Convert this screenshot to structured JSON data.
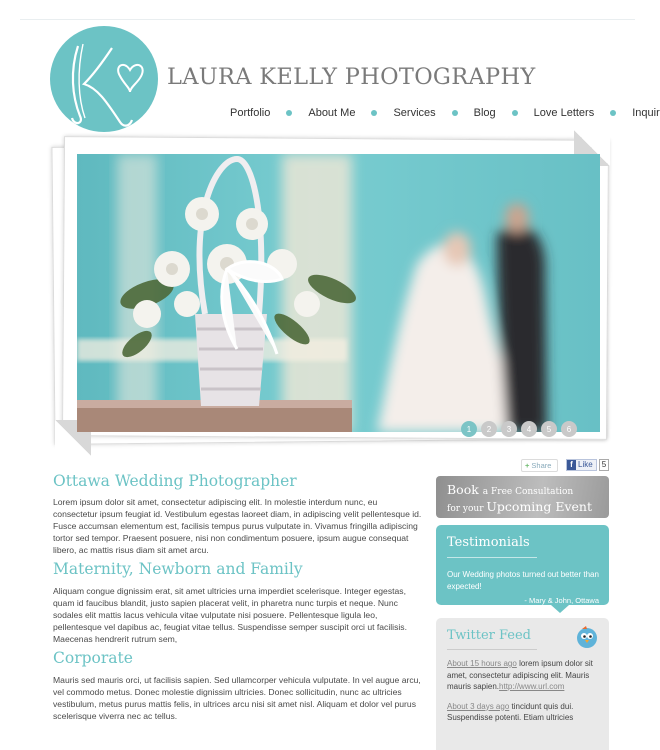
{
  "colors": {
    "accent": "#6cc3c5",
    "heading": "#7a7a7a",
    "panel": "#e9e9e9"
  },
  "brand": {
    "name": "LAURA KELLY PHOTOGRAPHY",
    "logo_initials": "K"
  },
  "nav": {
    "items": [
      "Portfolio",
      "About Me",
      "Services",
      "Blog",
      "Love Letters",
      "Inquiries"
    ]
  },
  "slider": {
    "pages": [
      "1",
      "2",
      "3",
      "4",
      "5",
      "6"
    ],
    "active_page": "1"
  },
  "social": {
    "share_label": "Share",
    "like_label": "Like",
    "like_count": "5"
  },
  "main": {
    "sections": [
      {
        "title": "Ottawa Wedding Photographer",
        "text": "Lorem ipsum dolor sit amet, consectetur adipiscing elit. In molestie interdum nunc, eu consectetur ipsum feugiat id. Vestibulum egestas laoreet diam, in adipiscing velit pellentesque id. Fusce accumsan elementum est, facilisis tempus purus vulputate in. Vivamus fringilla adipiscing tortor sed tempor. Praesent posuere, nisi non condimentum posuere, ipsum augue consequat libero, ac mattis risus diam sit amet arcu."
      },
      {
        "title": "Maternity, Newborn and Family",
        "text": "Aliquam congue dignissim erat, sit amet ultricies urna imperdiet scelerisque. Integer egestas, quam id faucibus blandit, justo sapien placerat velit, in pharetra nunc turpis et neque. Nunc sodales elit mattis lacus vehicula vitae vulputate nisi posuere. Pellentesque ligula leo, pellentesque vel dapibus ac, feugiat vitae tellus. Suspendisse semper suscipit orci ut facilisis. Maecenas hendrerit rutrum sem,"
      },
      {
        "title": "Corporate",
        "text": "Mauris sed mauris orci, ut facilisis sapien. Sed ullamcorper vehicula vulputate. In vel augue arcu, vel commodo metus. Donec molestie dignissim ultricies. Donec sollicitudin, nunc ac ultricies vestibulum, metus purus mattis felis, in ultrices arcu nisi sit amet nisl. Aliquam et dolor vel purus scelerisque viverra nec ac tellus."
      }
    ]
  },
  "sidebar": {
    "book": {
      "word1": "Book",
      "word2": "a Free Consultation",
      "word3": "for your",
      "word4": "Upcoming Event"
    },
    "testimonials": {
      "title": "Testimonials",
      "quote": "Our Wedding photos turned out better than expected!",
      "author": "- Mary & John, Ottawa"
    },
    "twitter": {
      "title": "Twitter Feed",
      "tweets": [
        {
          "time": "About 15 hours ago",
          "text": "lorem ipsum dolor sit amet, consectetur adipiscing elit. Mauris mauris sapien.",
          "link": "http://www.url.com"
        },
        {
          "time": "About 3 days ago",
          "text": "tincidunt quis dui. Suspendisse potenti. Etiam ultricies"
        }
      ]
    }
  }
}
